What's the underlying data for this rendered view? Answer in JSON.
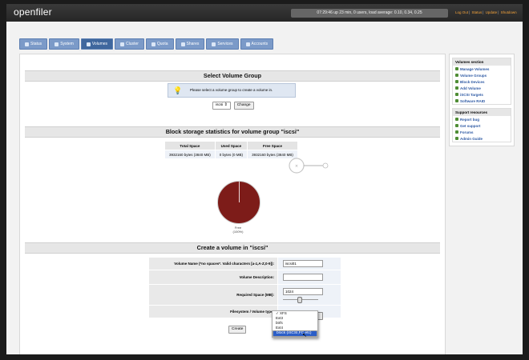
{
  "header": {
    "logo": "openfiler",
    "status": "07:29:46 up 23 min, 0 users, load average: 0.10, 0.34, 0.25",
    "links": [
      "Log Out",
      "Status",
      "Update",
      "Shutdown"
    ]
  },
  "tabs": [
    "Status",
    "System",
    "Volumes",
    "Cluster",
    "Quota",
    "Shares",
    "Services",
    "Accounts"
  ],
  "select_vg": {
    "title": "Select Volume Group",
    "info": "Please select a volume group to create a volume in.",
    "selected": "iscsi",
    "change_label": "Change"
  },
  "stats": {
    "title": "Block storage statistics for volume group \"iscsi\"",
    "headers": [
      "Total Space",
      "Used Space",
      "Free Space"
    ],
    "row": [
      "3932160 bytes (3840 MB)",
      "0 bytes (0 MB)",
      "3932160 bytes (3840 MB)"
    ],
    "pie_label": "Free",
    "pie_percent": "(100%)"
  },
  "create": {
    "title": "Create a volume in \"iscsi\"",
    "name_label": "Volume Name (*no spaces*. Valid characters [a-z,A-Z,0-9]):",
    "name_value": "iscsi01",
    "desc_label": "Volume Description:",
    "desc_value": "",
    "space_label": "Required Space (MB):",
    "space_value": "1024",
    "fs_label": "Filesystem / Volume type:",
    "fs_options": [
      "XFS",
      "Ext3",
      "btrfs",
      "Ext4",
      "block (iSCSI,FC,etc)"
    ],
    "create_label": "Create"
  },
  "sidebar": {
    "volumes_title": "Volumes section",
    "volumes_items": [
      "Manage Volumes",
      "Volume Groups",
      "Block Devices",
      "Add Volume",
      "iSCSI Targets",
      "Software RAID"
    ],
    "support_title": "Support resources",
    "support_items": [
      "Report bug",
      "Get support",
      "Forums",
      "Admin Guide"
    ]
  },
  "colors": {
    "pie_free": "#7d1c19",
    "tab_active": "#3f679e",
    "link": "#2c58a3"
  }
}
